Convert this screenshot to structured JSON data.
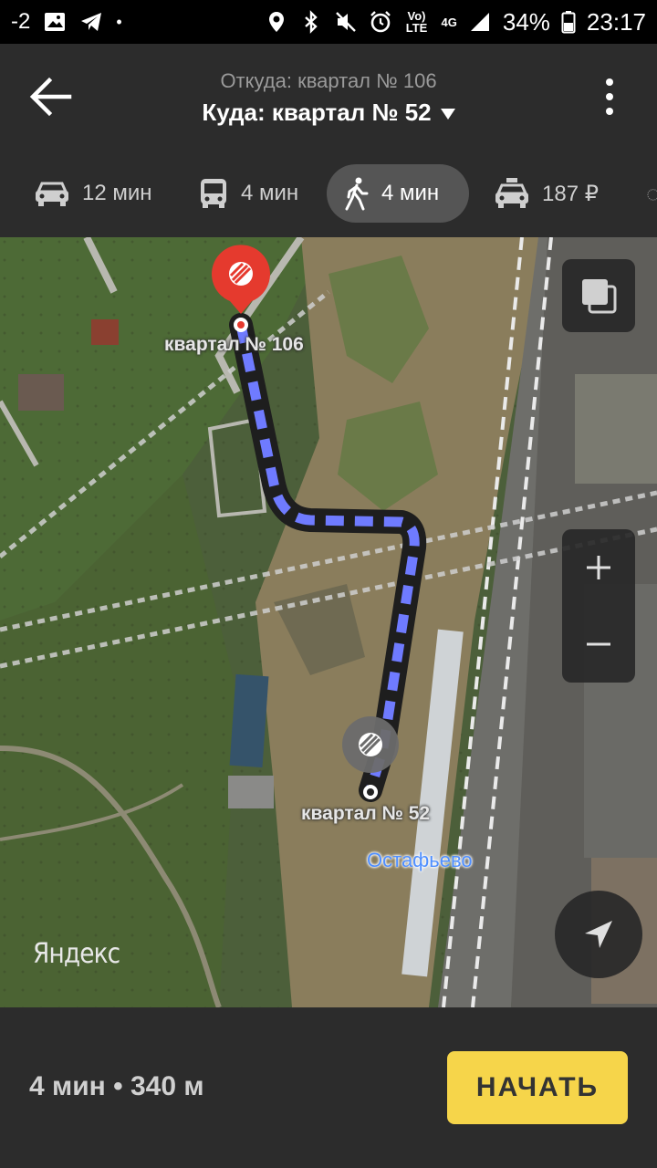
{
  "status_bar": {
    "left_text": "-2",
    "battery": "34%",
    "time": "23:17",
    "network_label": "4G",
    "volte_label": "Vo) LTE"
  },
  "header": {
    "from_label": "Откуда: квартал № 106",
    "to_label": "Куда: квартал № 52",
    "back_icon": "arrow-left-icon",
    "menu_icon": "more-vert-icon"
  },
  "modes": [
    {
      "id": "car",
      "icon": "car-icon",
      "label": "12 мин",
      "active": false
    },
    {
      "id": "bus",
      "icon": "bus-icon",
      "label": "4 мин",
      "active": false
    },
    {
      "id": "walk",
      "icon": "walk-icon",
      "label": "4 мин",
      "active": true
    },
    {
      "id": "taxi",
      "icon": "taxi-icon",
      "label": "187 ₽",
      "active": false
    }
  ],
  "map": {
    "start_label": "квартал № 106",
    "end_label": "квартал № 52",
    "station_label": "Остафьево",
    "watermark": "Яндекс",
    "route_color": "#6f7bff",
    "start_marker_color": "#e53a2e"
  },
  "bottom": {
    "summary": "4 мин • 340 м",
    "start_button": "НАЧАТЬ"
  },
  "colors": {
    "accent_yellow": "#f6d54a",
    "panel_bg": "#2c2c2c"
  }
}
